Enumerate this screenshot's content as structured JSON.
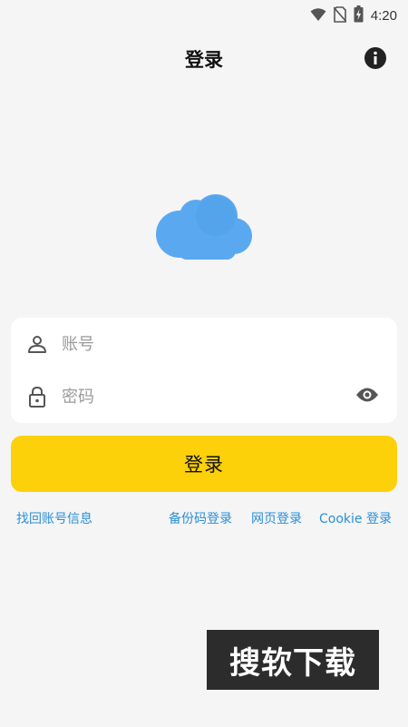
{
  "status_bar": {
    "time": "4:20",
    "icons": [
      "wifi-icon",
      "no-sim-icon",
      "battery-charging-icon"
    ]
  },
  "header": {
    "title": "登录",
    "info_icon": "info-icon"
  },
  "logo": {
    "icon": "cloud-icon",
    "color": "#5aa9f0"
  },
  "form": {
    "account": {
      "placeholder": "账号",
      "value": "",
      "icon": "user-icon"
    },
    "password": {
      "placeholder": "密码",
      "value": "",
      "icon": "lock-icon",
      "toggle_icon": "eye-icon"
    }
  },
  "login_button": {
    "label": "登录",
    "color": "#fdd10a"
  },
  "links": {
    "recover": "找回账号信息",
    "backup_code": "备份码登录",
    "web": "网页登录",
    "cookie": "Cookie 登录",
    "color": "#2a8ed8"
  },
  "watermark": {
    "text": "搜软下载"
  }
}
